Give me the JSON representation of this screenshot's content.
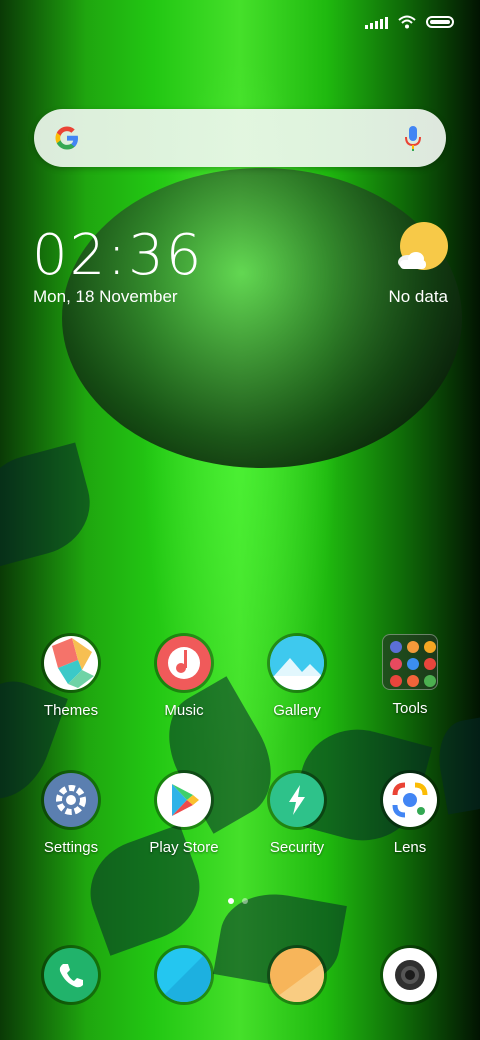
{
  "status_bar": {
    "icons": [
      "signal-icon",
      "wifi-icon",
      "battery-icon"
    ]
  },
  "search_bar": {
    "logo": "G",
    "icons": [
      "google-logo-icon",
      "mic-icon"
    ]
  },
  "clock_widget": {
    "time": "02:36",
    "date": "Mon, 18 November"
  },
  "weather_widget": {
    "icon": "partly-sunny-icon",
    "status": "No data"
  },
  "apps_row1": [
    {
      "label": "Themes",
      "icon": "themes-icon"
    },
    {
      "label": "Music",
      "icon": "music-icon"
    },
    {
      "label": "Gallery",
      "icon": "gallery-icon"
    },
    {
      "label": "Tools",
      "icon": "folder-icon"
    }
  ],
  "apps_row2": [
    {
      "label": "Settings",
      "icon": "gear-icon"
    },
    {
      "label": "Play Store",
      "icon": "play-store-icon"
    },
    {
      "label": "Security",
      "icon": "security-icon"
    },
    {
      "label": "Lens",
      "icon": "lens-icon"
    }
  ],
  "page_indicator": {
    "pages": 2,
    "current": 1
  },
  "dock": [
    {
      "icon": "phone-icon"
    },
    {
      "icon": "messages-icon"
    },
    {
      "icon": "browser-icon"
    },
    {
      "icon": "camera-icon"
    }
  ],
  "colors": {
    "wallpaper_green": "#22c713",
    "text": "#ffffff",
    "search_bg": "#eef5ee",
    "weather_sun": "#f7c948"
  }
}
